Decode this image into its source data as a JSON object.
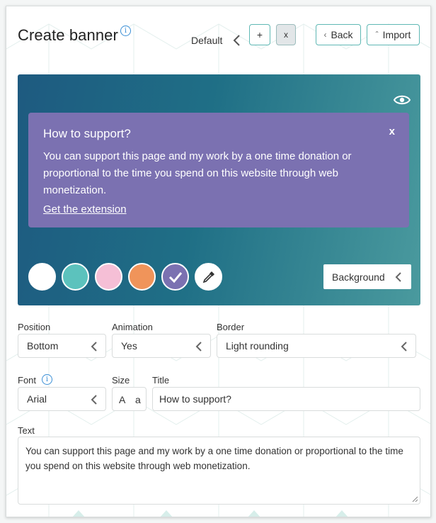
{
  "header": {
    "title": "Create banner",
    "variant_label": "Default",
    "add_label": "+",
    "remove_label": "x",
    "back_label": "Back",
    "import_label": "Import"
  },
  "preview": {
    "banner": {
      "title": "How to support?",
      "close_label": "x",
      "text": "You can support this page and my work by a one time donation or proportional to the time you spend on this website through web monetization.",
      "link": "Get the extension"
    },
    "swatches": [
      {
        "color": "#ffffff",
        "selected": false
      },
      {
        "color": "#5cc2bd",
        "selected": false
      },
      {
        "color": "#f5bfd6",
        "selected": false
      },
      {
        "color": "#f0945a",
        "selected": false
      },
      {
        "color": "#7b71b1",
        "selected": true
      }
    ],
    "color_target": "Background"
  },
  "form": {
    "position": {
      "label": "Position",
      "value": "Bottom"
    },
    "animation": {
      "label": "Animation",
      "value": "Yes"
    },
    "border": {
      "label": "Border",
      "value": "Light rounding"
    },
    "font": {
      "label": "Font",
      "value": "Arial"
    },
    "size": {
      "label": "Size",
      "larger": "A",
      "smaller": "a"
    },
    "title": {
      "label": "Title",
      "value": "How to support?"
    },
    "text": {
      "label": "Text",
      "value": "You can support this page and my work by a one time donation or proportional to the time you spend on this website through web monetization."
    }
  },
  "colors": {
    "accent": "#5fb8b4",
    "banner": "#7b71b1",
    "info": "#3a8fd6"
  }
}
